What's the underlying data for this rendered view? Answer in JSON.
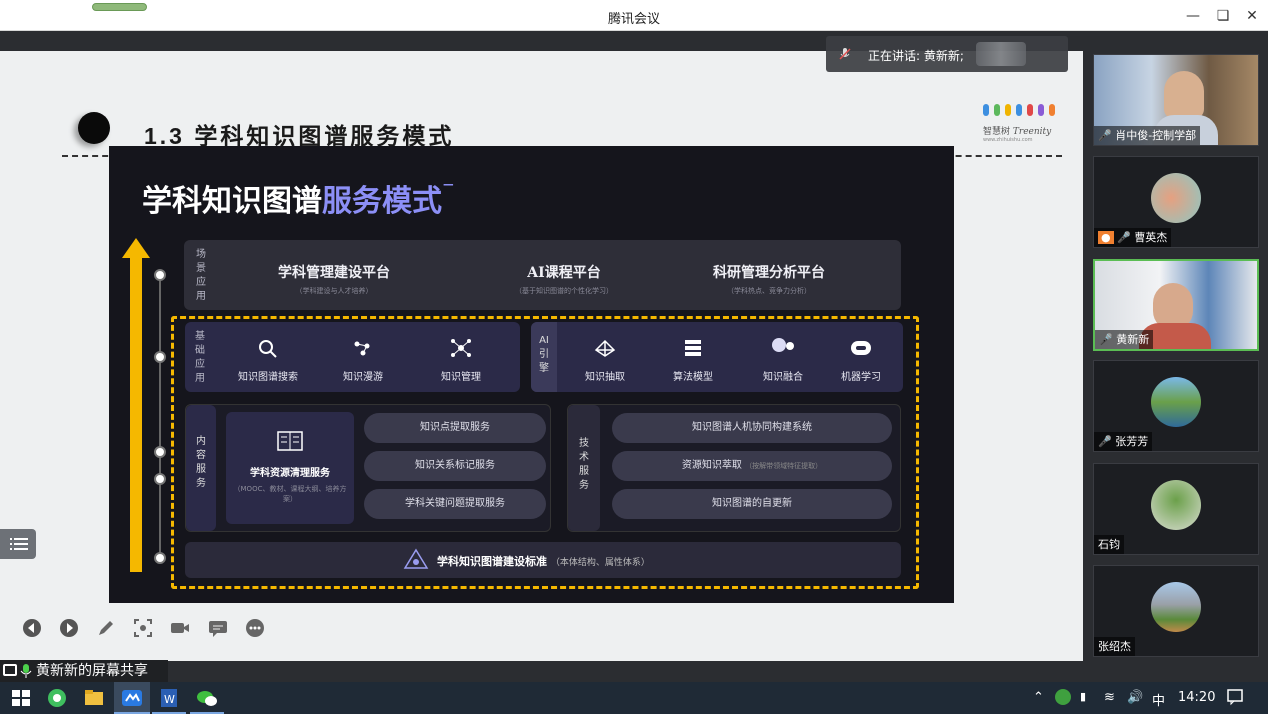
{
  "window": {
    "title": "腾讯会议"
  },
  "speaking": {
    "label": "正在讲话: 黄新新;"
  },
  "slide": {
    "title": "1.3 学科知识图谱服务模式",
    "logo": {
      "name": "智慧树",
      "brand": "Treenity",
      "url": "www.zhihuishu.com"
    },
    "inner": {
      "title_main": "学科知识图谱",
      "title_accent": "服务模式",
      "scenario": {
        "label": "场景应用",
        "items": [
          {
            "title": "学科管理建设平台",
            "sub": "（学科建设与人才培养）"
          },
          {
            "title": "AI课程平台",
            "sub": "（基于知识图谱的个性化学习）"
          },
          {
            "title": "科研管理分析平台",
            "sub": "（学科热点、竞争力分析）"
          }
        ]
      },
      "basic": {
        "label": "基础应用",
        "items": [
          "知识图谱搜索",
          "知识漫游",
          "知识管理"
        ]
      },
      "ai_engine": {
        "label": "AI引擎",
        "items": [
          "知识抽取",
          "算法模型",
          "知识融合",
          "机器学习"
        ]
      },
      "content": {
        "label": "内容服务",
        "main_title": "学科资源清理服务",
        "main_sub": "（MOOC、教材、课程大纲、培养方案）",
        "pills": [
          "知识点提取服务",
          "知识关系标记服务",
          "学科关键问题提取服务"
        ]
      },
      "tech": {
        "label": "技术服务",
        "pills": [
          "知识图谱人机协同构建系统",
          "资源知识萃取",
          "知识图谱的自更新"
        ],
        "pill2_sub": "（按解带领域特征提取）"
      },
      "standard": {
        "title": "学科知识图谱建设标准",
        "sub": "（本体结构、属性体系）"
      }
    }
  },
  "share_label": "黄新新的屏幕共享",
  "participants": [
    {
      "name": "肖中俊-控制学部",
      "muted": true
    },
    {
      "name": "曹英杰",
      "muted": true
    },
    {
      "name": "黄新新",
      "muted": false
    },
    {
      "name": "张芳芳",
      "muted": true
    },
    {
      "name": "石钧",
      "muted": false
    },
    {
      "name": "张绍杰",
      "muted": false
    }
  ],
  "taskbar": {
    "ime": "中",
    "time": "14:20"
  }
}
